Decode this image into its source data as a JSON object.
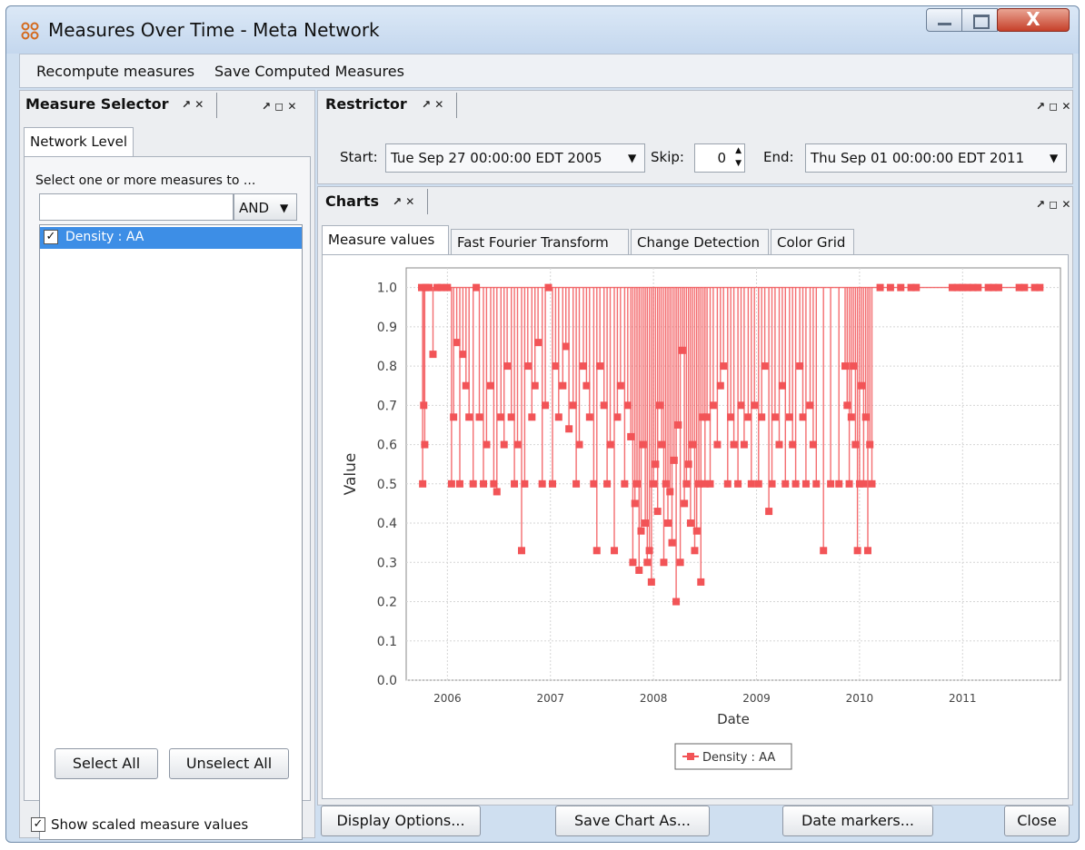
{
  "window": {
    "title": "Measures Over Time - Meta Network",
    "close_label": "X"
  },
  "menu": {
    "items": [
      "Recompute measures",
      "Save Computed Measures"
    ]
  },
  "dock_controls": "↗ ◻ ✕",
  "tab_controls": "↗ ✕",
  "measure_selector": {
    "title": "Measure Selector",
    "tab": "Network Level",
    "select_label": "Select one or more measures to ...",
    "filter_value": "",
    "mode": "AND",
    "items": [
      {
        "label": "Density : AA",
        "checked": true,
        "selected": true
      }
    ],
    "select_all": "Select All",
    "unselect_all": "Unselect All",
    "show_scaled": "Show scaled measure values",
    "show_scaled_checked": true
  },
  "restrictor": {
    "title": "Restrictor",
    "start_label": "Start:",
    "start_value": "Tue Sep 27 00:00:00 EDT 2005",
    "skip_label": "Skip:",
    "skip_value": "0",
    "end_label": "End:",
    "end_value": "Thu Sep 01 00:00:00 EDT 2011"
  },
  "charts": {
    "title": "Charts",
    "tabs": [
      "Measure values",
      "Fast Fourier Transform",
      "Change Detection",
      "Color Grid"
    ],
    "active_tab": 0
  },
  "buttons": {
    "display_options": "Display Options...",
    "save_chart": "Save Chart As...",
    "date_markers": "Date markers...",
    "close": "Close"
  },
  "chart_data": {
    "type": "line",
    "xlabel": "Date",
    "ylabel": "Value",
    "xlim": [
      2005.6,
      2011.95
    ],
    "ylim": [
      0.0,
      1.05
    ],
    "x_ticks": [
      "2006",
      "2007",
      "2008",
      "2009",
      "2010",
      "2011"
    ],
    "y_ticks": [
      "0.0",
      "0.1",
      "0.2",
      "0.3",
      "0.4",
      "0.5",
      "0.6",
      "0.7",
      "0.8",
      "0.9",
      "1.0"
    ],
    "legend": "bottom",
    "grid": true,
    "color": "#f25457",
    "series": [
      {
        "name": "Density : AA",
        "x": [
          2005.75,
          2005.76,
          2005.77,
          2005.78,
          2005.79,
          2005.82,
          2005.86,
          2005.9,
          2005.94,
          2006.0,
          2006.04,
          2006.06,
          2006.09,
          2006.12,
          2006.15,
          2006.18,
          2006.21,
          2006.25,
          2006.28,
          2006.31,
          2006.35,
          2006.38,
          2006.42,
          2006.45,
          2006.48,
          2006.52,
          2006.55,
          2006.58,
          2006.62,
          2006.65,
          2006.68,
          2006.72,
          2006.75,
          2006.78,
          2006.82,
          2006.85,
          2006.88,
          2006.92,
          2006.95,
          2006.98,
          2007.02,
          2007.05,
          2007.08,
          2007.12,
          2007.15,
          2007.18,
          2007.22,
          2007.25,
          2007.28,
          2007.32,
          2007.35,
          2007.38,
          2007.42,
          2007.45,
          2007.48,
          2007.52,
          2007.55,
          2007.58,
          2007.62,
          2007.65,
          2007.68,
          2007.72,
          2007.75,
          2007.78,
          2007.8,
          2007.82,
          2007.84,
          2007.86,
          2007.88,
          2007.9,
          2007.92,
          2007.94,
          2007.96,
          2007.98,
          2008.0,
          2008.02,
          2008.04,
          2008.06,
          2008.08,
          2008.1,
          2008.12,
          2008.14,
          2008.16,
          2008.18,
          2008.2,
          2008.22,
          2008.24,
          2008.26,
          2008.28,
          2008.3,
          2008.32,
          2008.34,
          2008.36,
          2008.38,
          2008.4,
          2008.42,
          2008.44,
          2008.46,
          2008.48,
          2008.5,
          2008.52,
          2008.55,
          2008.58,
          2008.62,
          2008.65,
          2008.68,
          2008.72,
          2008.75,
          2008.78,
          2008.82,
          2008.85,
          2008.88,
          2008.92,
          2008.95,
          2008.98,
          2009.02,
          2009.05,
          2009.08,
          2009.12,
          2009.15,
          2009.18,
          2009.22,
          2009.25,
          2009.28,
          2009.32,
          2009.35,
          2009.38,
          2009.42,
          2009.45,
          2009.48,
          2009.52,
          2009.55,
          2009.58,
          2009.65,
          2009.72,
          2009.8,
          2009.86,
          2009.88,
          2009.9,
          2009.92,
          2009.94,
          2009.96,
          2009.98,
          2010.0,
          2010.02,
          2010.04,
          2010.06,
          2010.08,
          2010.1,
          2010.12,
          2010.2,
          2010.3,
          2010.4,
          2010.5,
          2010.55,
          2010.9,
          2010.95,
          2011.0,
          2011.05,
          2011.1,
          2011.15,
          2011.25,
          2011.3,
          2011.35,
          2011.55,
          2011.6,
          2011.7,
          2011.75
        ],
        "y": [
          1.0,
          0.5,
          0.7,
          0.6,
          1.0,
          1.0,
          0.83,
          1.0,
          1.0,
          1.0,
          0.5,
          0.67,
          0.86,
          0.5,
          0.83,
          0.75,
          0.67,
          0.5,
          1.0,
          0.67,
          0.5,
          0.6,
          0.75,
          0.5,
          0.48,
          0.67,
          0.6,
          0.8,
          0.67,
          0.5,
          0.6,
          0.33,
          0.5,
          0.8,
          0.67,
          0.75,
          0.86,
          0.5,
          0.7,
          1.0,
          0.5,
          0.8,
          0.67,
          0.75,
          0.85,
          0.64,
          0.7,
          0.5,
          0.6,
          0.8,
          0.75,
          0.67,
          0.5,
          0.33,
          0.8,
          0.7,
          0.5,
          0.6,
          0.33,
          0.67,
          0.75,
          0.5,
          0.7,
          0.62,
          0.3,
          0.45,
          0.5,
          0.28,
          0.38,
          0.6,
          0.4,
          0.3,
          0.33,
          0.25,
          0.5,
          0.55,
          0.43,
          0.7,
          0.6,
          0.3,
          0.5,
          0.4,
          0.48,
          0.35,
          0.56,
          0.2,
          0.65,
          0.3,
          0.84,
          0.45,
          0.5,
          0.55,
          0.4,
          0.6,
          0.33,
          0.38,
          0.5,
          0.25,
          0.67,
          0.5,
          0.67,
          0.5,
          0.7,
          0.6,
          0.75,
          0.8,
          0.5,
          0.67,
          0.6,
          0.5,
          0.7,
          0.6,
          0.67,
          0.5,
          0.7,
          0.5,
          0.67,
          0.8,
          0.43,
          0.5,
          0.67,
          0.6,
          0.75,
          0.5,
          0.67,
          0.6,
          0.5,
          0.8,
          0.67,
          0.5,
          0.7,
          0.6,
          0.5,
          0.33,
          0.5,
          0.5,
          0.8,
          0.7,
          0.5,
          0.67,
          0.8,
          0.6,
          0.33,
          0.5,
          0.75,
          0.5,
          0.67,
          0.33,
          0.6,
          0.5,
          1.0,
          1.0,
          1.0,
          1.0,
          1.0,
          1.0,
          1.0,
          1.0,
          1.0,
          1.0,
          1.0,
          1.0,
          1.0,
          1.0,
          1.0,
          1.0,
          1.0,
          1.0
        ]
      }
    ]
  }
}
